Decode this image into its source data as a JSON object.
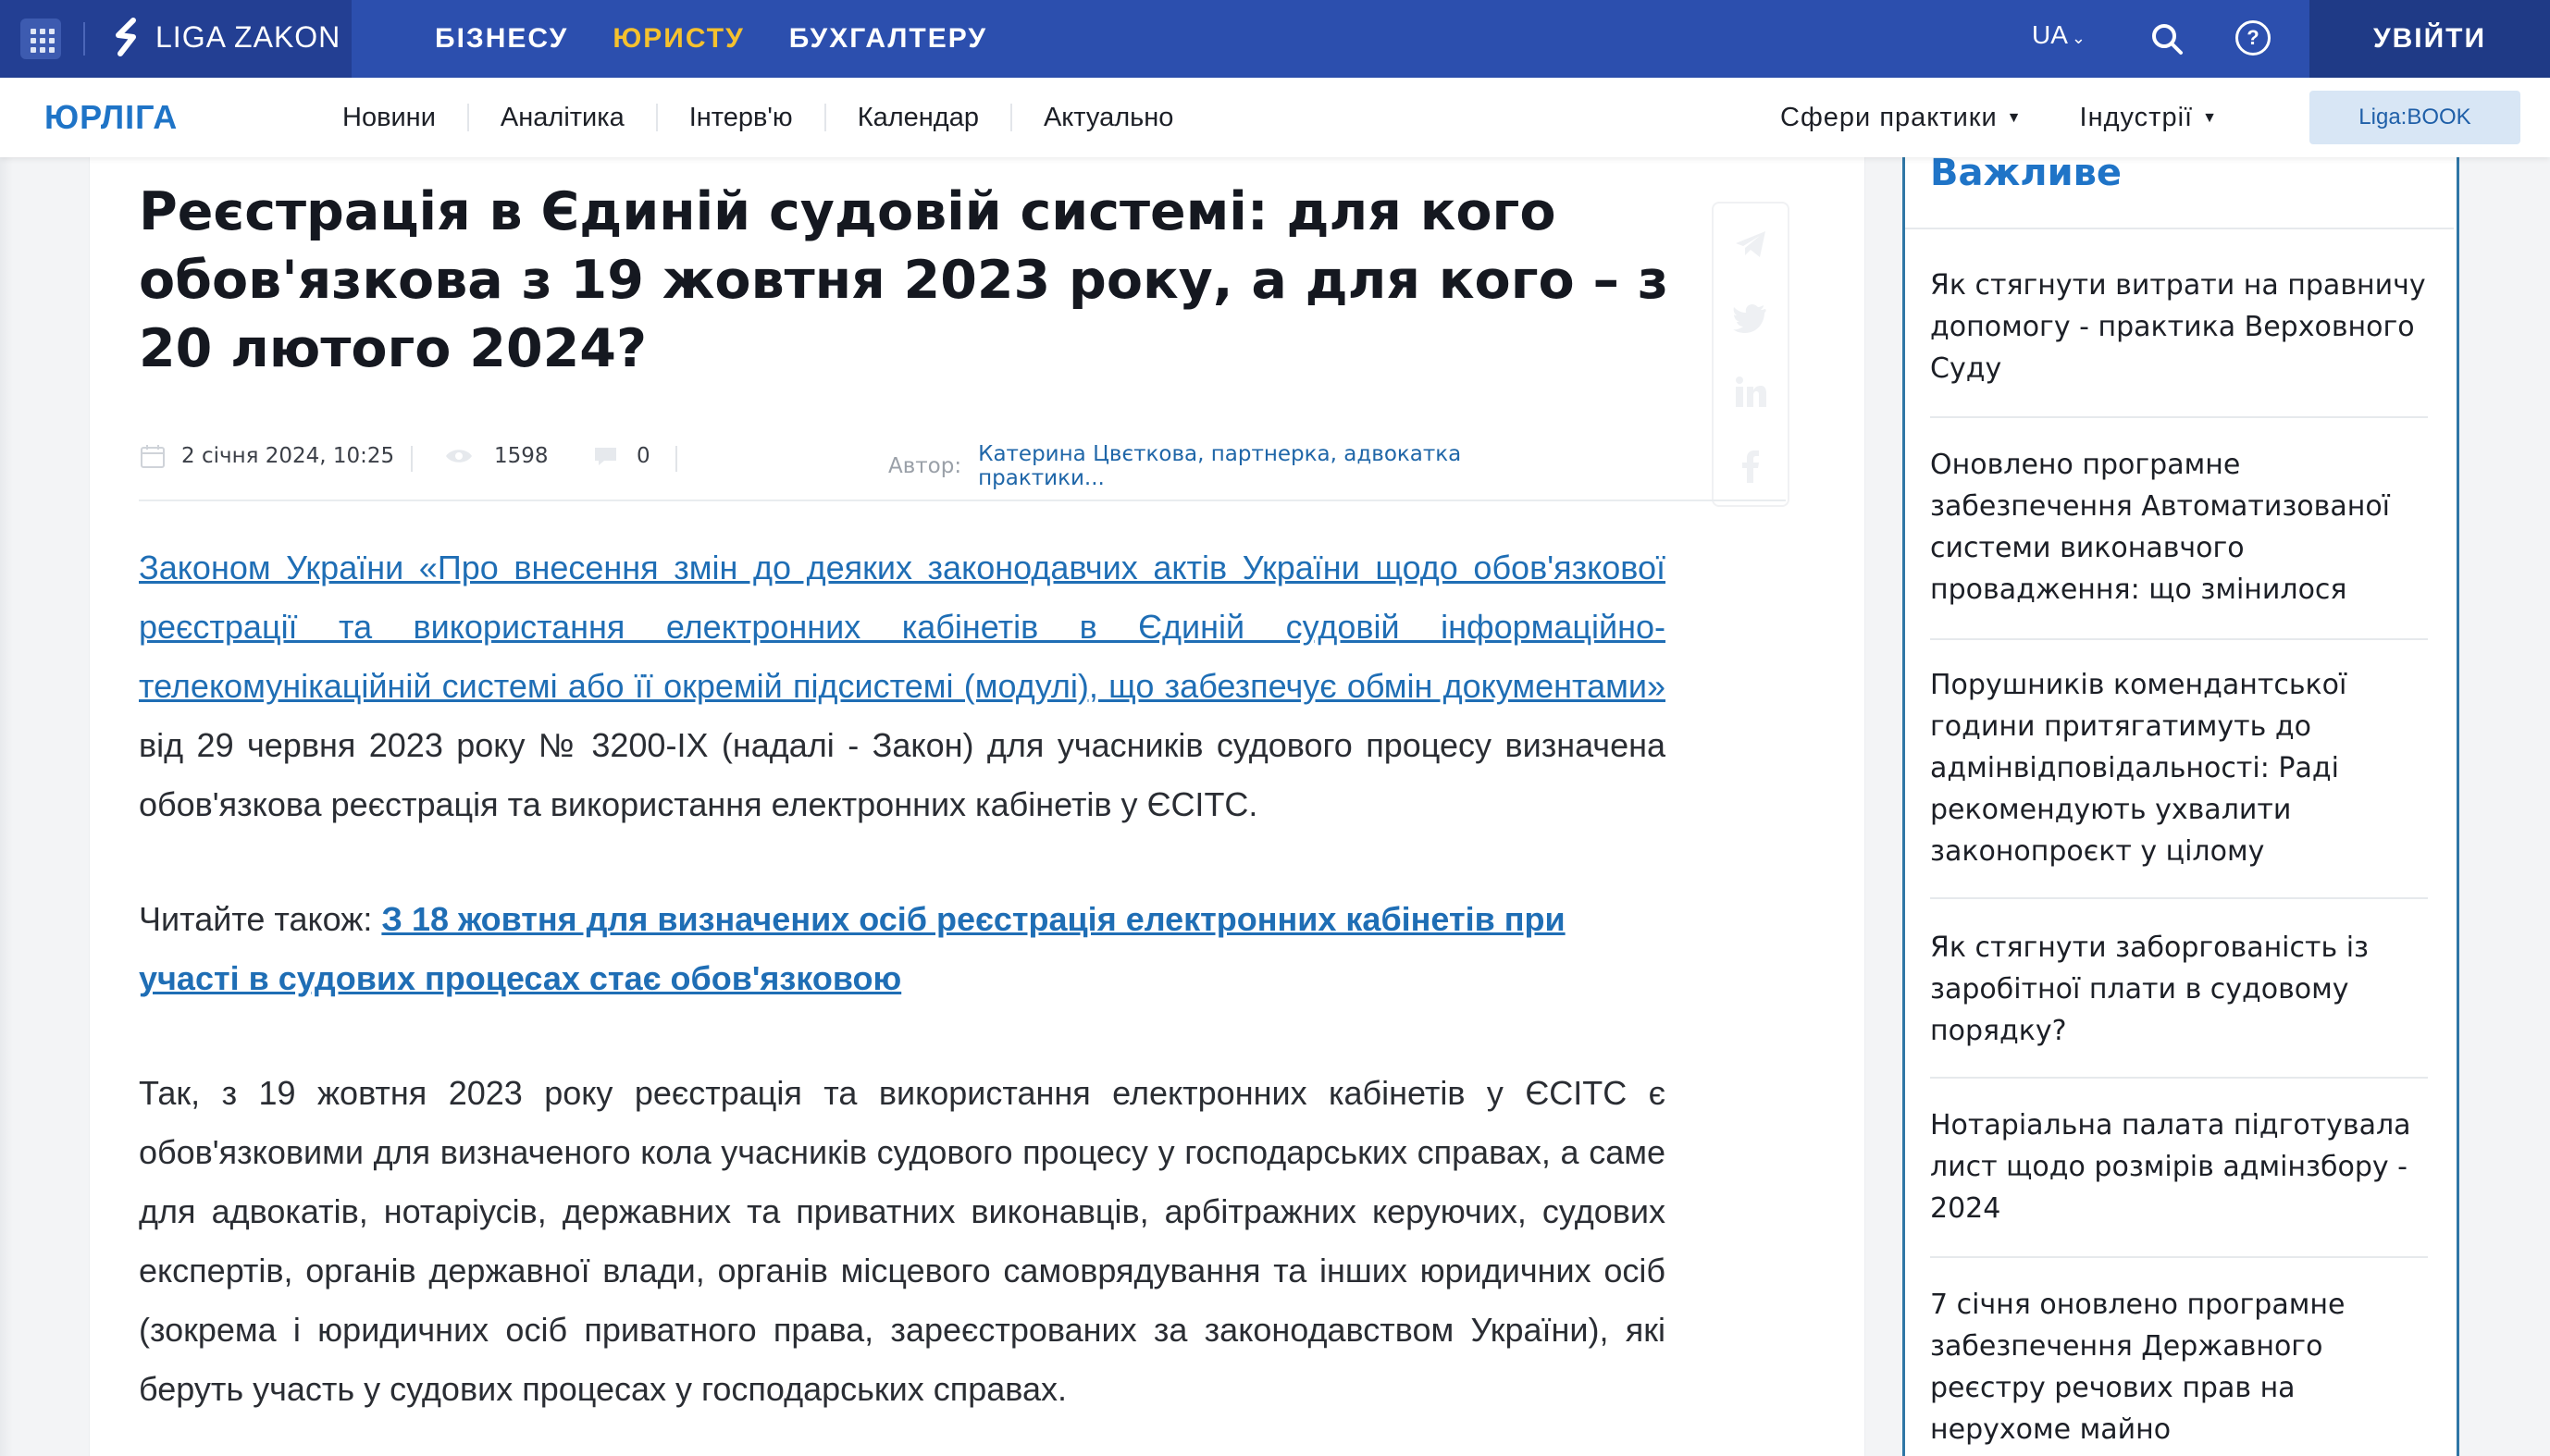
{
  "topbar": {
    "logo_text": "LIGA ZAKON",
    "nav": [
      {
        "label": "БІЗНЕСУ",
        "active": false
      },
      {
        "label": "ЮРИСТУ",
        "active": true
      },
      {
        "label": "БУХГАЛТЕРУ",
        "active": false
      }
    ],
    "language": "UA",
    "login_label": "УВІЙТИ",
    "colors": {
      "bar": "#2c4fae",
      "active_nav": "#f5c12e"
    }
  },
  "subbar": {
    "brand": "ЮРЛІГА",
    "nav": [
      "Новини",
      "Аналітика",
      "Інтерв'ю",
      "Календар",
      "Актуально"
    ],
    "dropdowns": [
      "Сфери практики",
      "Індустрії"
    ],
    "book_label": "Liga:BOOK"
  },
  "article": {
    "title": "Реєстрація в Єдиній судовій системі: для кого обов'язкова з 19 жовтня 2023 року, а для кого – з 20 лютого 2024?",
    "meta": {
      "date": "2 січня 2024, 10:25",
      "views": "1598",
      "comments": "0",
      "author_label": "Автор:",
      "author": "Катерина Цвєткова, партнерка, адвокатка практики..."
    },
    "p1_link": "Законом України «Про внесення змін до деяких законодавчих актів України щодо обов'язкової реєстрації та використання електронних кабінетів в Єдиній судовій інформаційно-телекомунікаційній системі або її окремій підсистемі (модулі), що забезпечує обмін документами»",
    "p1_text": " від 29 червня 2023 року №  3200-IX (надалі - Закон) для учасників судового процесу визначена обов'язкова реєстрація та використання електронних кабінетів у ЄСІТС.",
    "read_also_label": "Читайте також: ",
    "read_also_link": "З 18 жовтня для визначених осіб реєстрація електронних кабінетів при участі в судових процесах стає обов'язковою",
    "p3": "Так, з 19 жовтня 2023 року реєстрація та використання електронних кабінетів у ЄСІТС є обов'язковими для визначеного кола учасників судового процесу у господарських справах, а саме для адвокатів, нотаріусів, державних та приватних виконавців, арбітражних керуючих, судових експертів, органів державної влади, органів місцевого самоврядування та інших юридичних осіб (зокрема і юридичних осіб приватного права, зареєстрованих за законодавством України), які беруть участь у судових процесах у господарських справах."
  },
  "sidebar": {
    "title": "Важливе",
    "items": [
      {
        "text": "Як стягнути витрати на правничу допомогу - практика Верховного Суду"
      },
      {
        "text": "Оновлено програмне забезпечення Автоматизованої системи виконавчого провадження: що змінилося"
      },
      {
        "text": "Порушників комендантської години притягатимуть до адмінвідповідальності: Раді рекомендують ухвалити законопроєкт у цілому"
      },
      {
        "text": "Як стягнути заборгованість із заробітної плати в судовому порядку?"
      },
      {
        "text": "Нотаріальна палата підготувала лист щодо розмірів адмінзбору - 2024"
      },
      {
        "text": "7 січня оновлено програмне забезпечення Державного реєстру речових прав на нерухоме майно"
      }
    ]
  },
  "icons": [
    "apps-grid-icon",
    "liga-logo-icon",
    "search-icon",
    "help-icon",
    "calendar-icon",
    "eye-icon",
    "comment-icon",
    "telegram-icon",
    "twitter-icon",
    "linkedin-icon",
    "facebook-icon"
  ]
}
